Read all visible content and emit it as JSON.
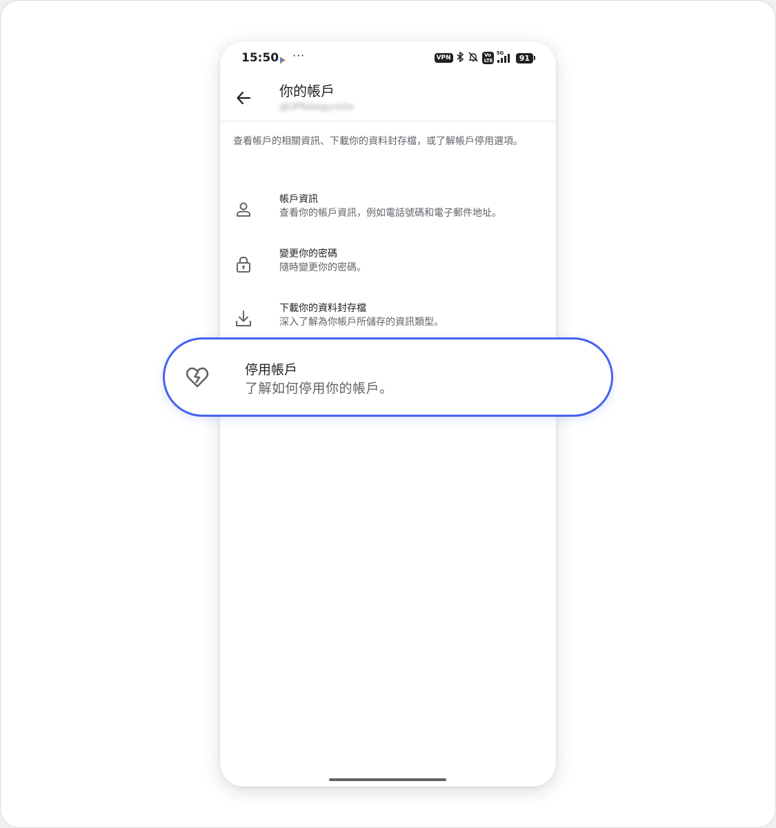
{
  "status_bar": {
    "time": "15:50",
    "vpn": "VPN",
    "network": "5G",
    "volte": "Vo LTE",
    "battery": "91"
  },
  "app_bar": {
    "title": "你的帳戶",
    "subtitle": "@UPNdaigynsite"
  },
  "intro_text": "查看帳戶的相關資訊、下載你的資料封存檔，或了解帳戶停用選項。",
  "menu": [
    {
      "title": "帳戶資訊",
      "description": "查看你的帳戶資訊，例如電話號碼和電子郵件地址。",
      "icon": "person-icon"
    },
    {
      "title": "變更你的密碼",
      "description": "隨時變更你的密碼。",
      "icon": "lock-icon"
    },
    {
      "title": "下載你的資料封存檔",
      "description": "深入了解為你帳戶所儲存的資訊類型。",
      "icon": "download-icon"
    }
  ],
  "highlight": {
    "title": "停用帳戶",
    "description": "了解如何停用你的帳戶。",
    "icon": "broken-heart-icon"
  },
  "colors": {
    "highlight_border": "#4461f2",
    "icon": "#5f6368",
    "text_primary": "#1f1f1f",
    "text_secondary": "#5f6368"
  }
}
